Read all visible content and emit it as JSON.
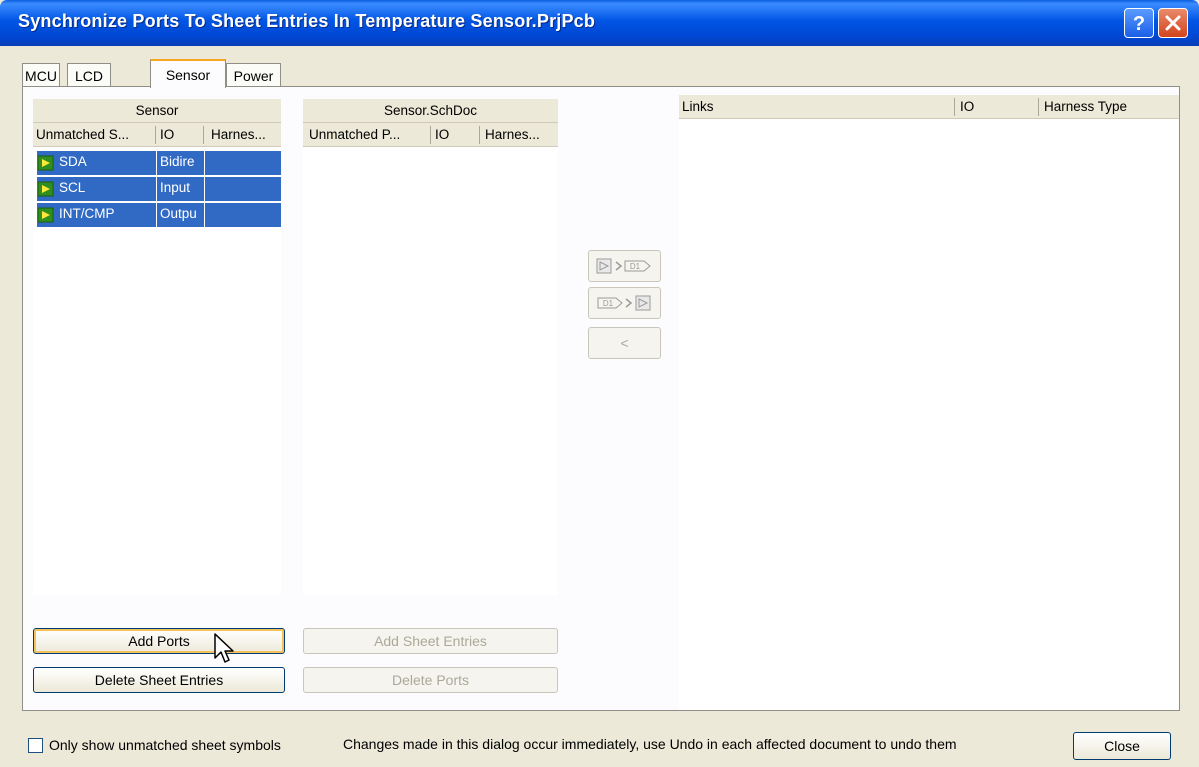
{
  "window": {
    "title": "Synchronize Ports To Sheet Entries In Temperature Sensor.PrjPcb"
  },
  "tabs": [
    "MCU",
    "LCD",
    "Sensor",
    "Power"
  ],
  "active_tab": "Sensor",
  "left_grid": {
    "group_header": "Sensor",
    "columns": [
      "Unmatched S...",
      "IO",
      "Harnes..."
    ],
    "rows": [
      {
        "name": "SDA",
        "io": "Bidire",
        "harness": ""
      },
      {
        "name": "SCL",
        "io": "Input",
        "harness": ""
      },
      {
        "name": "INT/CMP",
        "io": "Outpu",
        "harness": ""
      }
    ]
  },
  "middle_grid": {
    "group_header": "Sensor.SchDoc",
    "columns": [
      "Unmatched P...",
      "IO",
      "Harnes..."
    ]
  },
  "links_grid": {
    "columns": [
      "Links",
      "IO",
      "Harness Type"
    ]
  },
  "buttons": {
    "add_ports": "Add Ports",
    "delete_sheet_entries": "Delete Sheet Entries",
    "add_sheet_entries": "Add Sheet Entries",
    "delete_ports": "Delete Ports",
    "move_back": "<",
    "close": "Close"
  },
  "footer": {
    "checkbox_label": "Only show unmatched sheet symbols",
    "note": "Changes made in this dialog occur immediately, use Undo in each affected document to undo them"
  },
  "colors": {
    "selection": "#316ac5",
    "titlebar": "#0055e5",
    "dialog_bg": "#ece9d8"
  }
}
